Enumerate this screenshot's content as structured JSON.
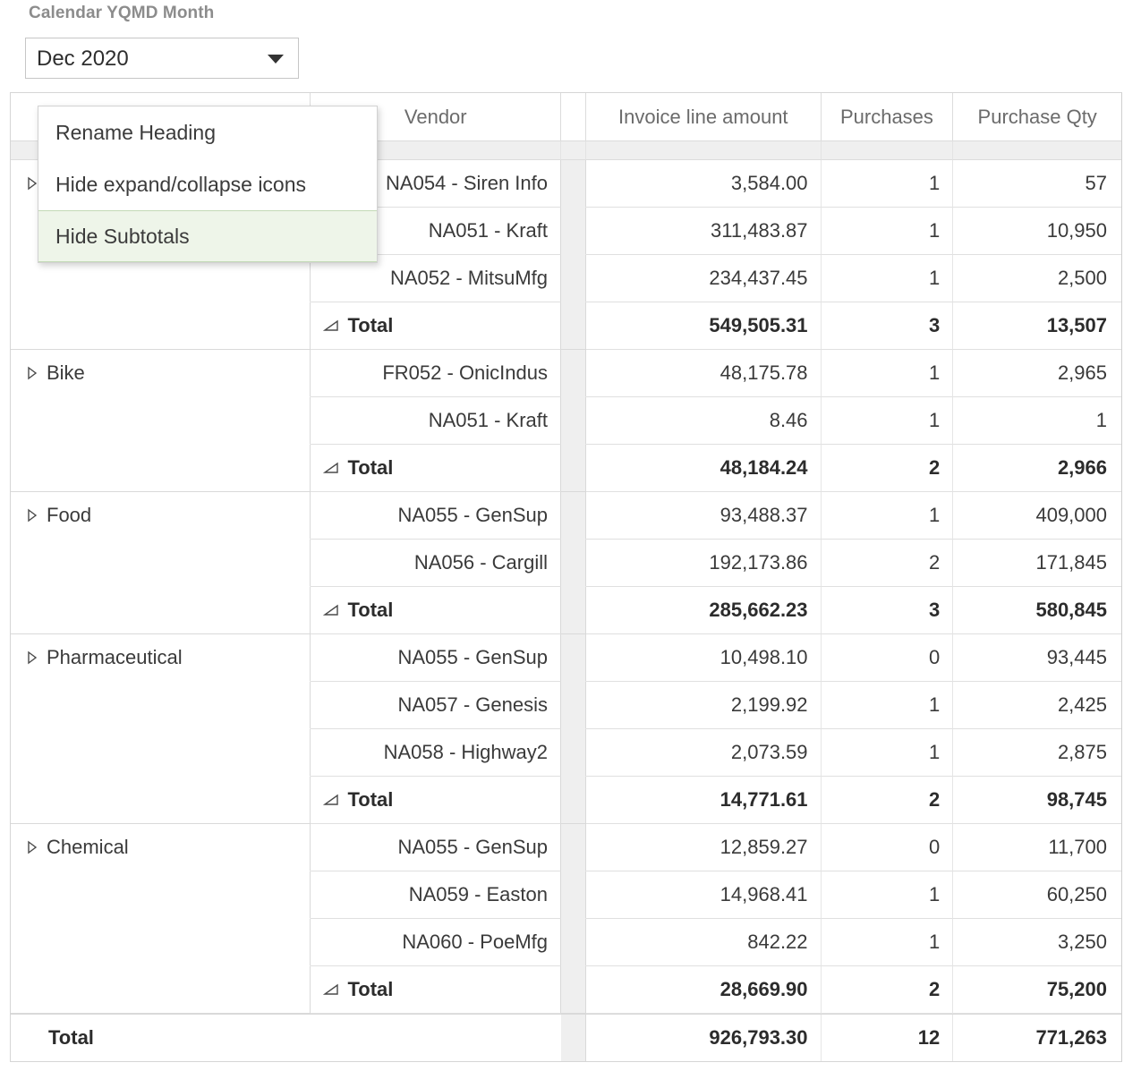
{
  "filter": {
    "label": "Calendar YQMD Month",
    "selected_value": "Dec 2020",
    "caret_icon": "chevron-down-icon"
  },
  "context_menu": {
    "items": [
      {
        "label": "Rename Heading",
        "highlighted": false
      },
      {
        "label": "Hide expand/collapse icons",
        "highlighted": false
      },
      {
        "label": "Hide Subtotals",
        "highlighted": true
      }
    ],
    "highlight_bg": "#eef5e9",
    "highlight_border": "#c3d9b6"
  },
  "table": {
    "columns": [
      {
        "key": "category",
        "label": ""
      },
      {
        "key": "vendor",
        "label": "Vendor"
      },
      {
        "key": "spacer",
        "label": ""
      },
      {
        "key": "amount",
        "label": "Invoice line amount"
      },
      {
        "key": "purchases",
        "label": "Purchases"
      },
      {
        "key": "qty",
        "label": "Purchase Qty"
      }
    ],
    "subtotal_label": "Total",
    "grand_total_label": "Total",
    "expand_icon": "expand-triangle-icon",
    "subtotal_icon": "subtotal-triangle-icon",
    "groups": [
      {
        "category": "",
        "rows": [
          {
            "vendor": "NA054 - Siren Info",
            "amount": "3,584.00",
            "purchases": "1",
            "qty": "57"
          },
          {
            "vendor": "NA051 - Kraft",
            "amount": "311,483.87",
            "purchases": "1",
            "qty": "10,950"
          },
          {
            "vendor": "NA052 - MitsuMfg",
            "amount": "234,437.45",
            "purchases": "1",
            "qty": "2,500"
          }
        ],
        "subtotal": {
          "amount": "549,505.31",
          "purchases": "3",
          "qty": "13,507"
        }
      },
      {
        "category": "Bike",
        "rows": [
          {
            "vendor": "FR052 - OnicIndus",
            "amount": "48,175.78",
            "purchases": "1",
            "qty": "2,965"
          },
          {
            "vendor": "NA051 - Kraft",
            "amount": "8.46",
            "purchases": "1",
            "qty": "1"
          }
        ],
        "subtotal": {
          "amount": "48,184.24",
          "purchases": "2",
          "qty": "2,966"
        }
      },
      {
        "category": "Food",
        "rows": [
          {
            "vendor": "NA055 - GenSup",
            "amount": "93,488.37",
            "purchases": "1",
            "qty": "409,000"
          },
          {
            "vendor": "NA056 - Cargill",
            "amount": "192,173.86",
            "purchases": "2",
            "qty": "171,845"
          }
        ],
        "subtotal": {
          "amount": "285,662.23",
          "purchases": "3",
          "qty": "580,845"
        }
      },
      {
        "category": "Pharmaceutical",
        "rows": [
          {
            "vendor": "NA055 - GenSup",
            "amount": "10,498.10",
            "purchases": "0",
            "qty": "93,445"
          },
          {
            "vendor": "NA057 - Genesis",
            "amount": "2,199.92",
            "purchases": "1",
            "qty": "2,425"
          },
          {
            "vendor": "NA058 - Highway2",
            "amount": "2,073.59",
            "purchases": "1",
            "qty": "2,875"
          }
        ],
        "subtotal": {
          "amount": "14,771.61",
          "purchases": "2",
          "qty": "98,745"
        }
      },
      {
        "category": "Chemical",
        "rows": [
          {
            "vendor": "NA055 - GenSup",
            "amount": "12,859.27",
            "purchases": "0",
            "qty": "11,700"
          },
          {
            "vendor": "NA059 - Easton",
            "amount": "14,968.41",
            "purchases": "1",
            "qty": "60,250"
          },
          {
            "vendor": "NA060 - PoeMfg",
            "amount": "842.22",
            "purchases": "1",
            "qty": "3,250"
          }
        ],
        "subtotal": {
          "amount": "28,669.90",
          "purchases": "2",
          "qty": "75,200"
        }
      }
    ],
    "grand_total": {
      "amount": "926,793.30",
      "purchases": "12",
      "qty": "771,263"
    }
  }
}
